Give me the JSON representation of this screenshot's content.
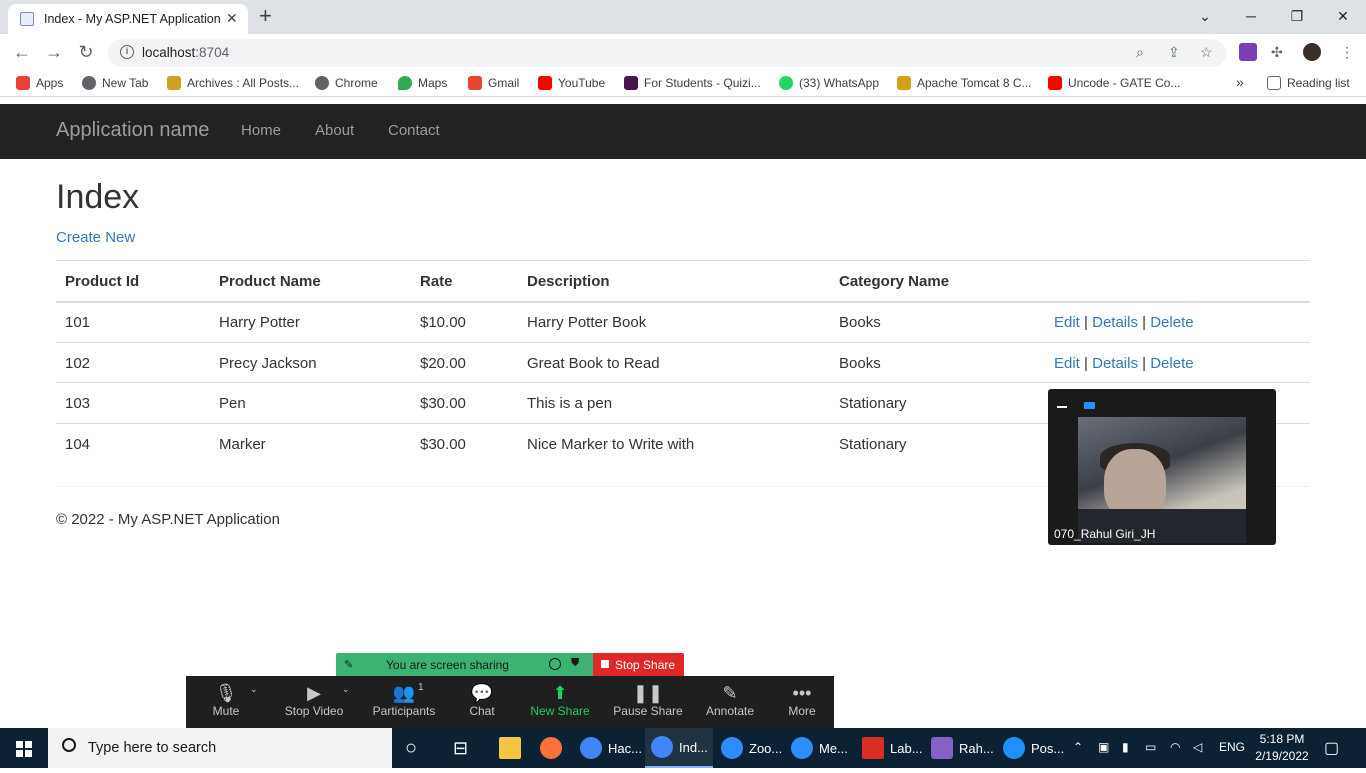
{
  "browser": {
    "tab_title": "Index - My ASP.NET Application",
    "url_host": "localhost",
    "url_port": ":8704",
    "bookmarks": [
      {
        "label": "Apps",
        "icon": "apps-grid-icon",
        "color": "#ea4335"
      },
      {
        "label": "New Tab",
        "icon": "globe-icon",
        "color": "#5f6368"
      },
      {
        "label": "Archives : All Posts...",
        "icon": "site-icon",
        "color": "#c9a227"
      },
      {
        "label": "Chrome",
        "icon": "globe-icon",
        "color": "#5f6368"
      },
      {
        "label": "Maps",
        "icon": "maps-pin-icon",
        "color": "#34a853"
      },
      {
        "label": "Gmail",
        "icon": "gmail-icon",
        "color": "#ea4335"
      },
      {
        "label": "YouTube",
        "icon": "youtube-icon",
        "color": "#ff0000"
      },
      {
        "label": "For Students - Quizi...",
        "icon": "quizizz-icon",
        "color": "#4a154b"
      },
      {
        "label": "(33) WhatsApp",
        "icon": "whatsapp-icon",
        "color": "#25d366"
      },
      {
        "label": "Apache Tomcat 8 C...",
        "icon": "tomcat-icon",
        "color": "#d4a017"
      },
      {
        "label": "Uncode - GATE Co...",
        "icon": "youtube-icon",
        "color": "#ff0000"
      }
    ],
    "overflow_label": "»",
    "reading_list": "Reading list"
  },
  "app": {
    "brand": "Application name",
    "nav": [
      "Home",
      "About",
      "Contact"
    ],
    "heading": "Index",
    "create_new": "Create New",
    "table": {
      "headers": [
        "Product Id",
        "Product Name",
        "Rate",
        "Description",
        "Category Name"
      ],
      "rows": [
        {
          "id": "101",
          "name": "Harry Potter",
          "rate": "$10.00",
          "desc": "Harry Potter Book",
          "cat": "Books"
        },
        {
          "id": "102",
          "name": "Precy Jackson",
          "rate": "$20.00",
          "desc": "Great Book to Read",
          "cat": "Books"
        },
        {
          "id": "103",
          "name": "Pen",
          "rate": "$30.00",
          "desc": "This is a pen",
          "cat": "Stationary"
        },
        {
          "id": "104",
          "name": "Marker",
          "rate": "$30.00",
          "desc": "Nice Marker to Write with",
          "cat": "Stationary"
        }
      ],
      "actions": {
        "edit": "Edit",
        "details": "Details",
        "delete": "Delete",
        "separator": "|"
      }
    },
    "footer": "© 2022 - My ASP.NET Application"
  },
  "zoom": {
    "video_name": "070_Rahul Giri_JH",
    "sharing_text": "You are screen sharing",
    "stop_share": "Stop Share",
    "participants_count": "1",
    "toolbar": [
      "Mute",
      "Stop Video",
      "Participants",
      "Chat",
      "New Share",
      "Pause Share",
      "Annotate",
      "More"
    ]
  },
  "taskbar": {
    "search_placeholder": "Type here to search",
    "apps": [
      {
        "label": "Hac...",
        "icon": "chrome-icon",
        "color": "#4285f4"
      },
      {
        "label": "Ind...",
        "icon": "chrome-icon",
        "color": "#4285f4"
      },
      {
        "label": "Zoo...",
        "icon": "zoom-icon",
        "color": "#2d8cff"
      },
      {
        "label": "Me...",
        "icon": "zoom-icon",
        "color": "#2d8cff"
      },
      {
        "label": "Lab...",
        "icon": "pdf-icon",
        "color": "#d93025"
      },
      {
        "label": "Rah...",
        "icon": "visual-studio-icon",
        "color": "#8661c5"
      },
      {
        "label": "Pos...",
        "icon": "postman-icon",
        "color": "#1e90ff"
      }
    ],
    "language": "ENG",
    "time": "5:18 PM",
    "date": "2/19/2022"
  },
  "colors": {
    "link": "#337ab7",
    "navbar": "#222222",
    "share_green": "#3cb371",
    "stop_red": "#e02828",
    "taskbar": "#0c2234"
  }
}
